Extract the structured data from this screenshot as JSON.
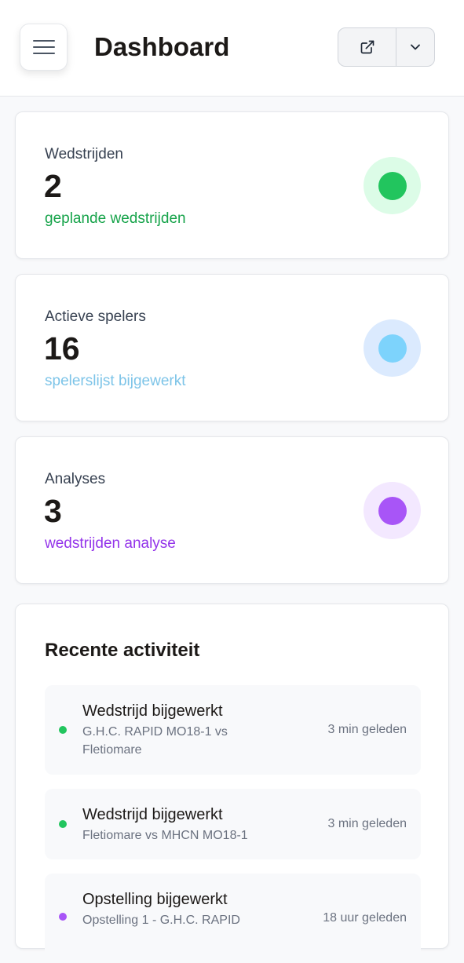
{
  "header": {
    "title": "Dashboard",
    "menu_icon": "hamburger-icon",
    "open_icon": "external-link-icon",
    "dropdown_icon": "chevron-down-icon"
  },
  "stats": [
    {
      "label": "Wedstrijden",
      "value": "2",
      "subtitle": "geplande wedstrijden",
      "accent": "#22c55e",
      "accent_text": "#16a34a",
      "accent_bg": "#dcfce7"
    },
    {
      "label": "Actieve spelers",
      "value": "16",
      "subtitle": "spelerslijst bijgewerkt",
      "accent": "#7dd3fc",
      "accent_text": "#7dc4e8",
      "accent_bg": "#dbeafe"
    },
    {
      "label": "Analyses",
      "value": "3",
      "subtitle": "wedstrijden analyse",
      "accent": "#a855f7",
      "accent_text": "#9333ea",
      "accent_bg": "#f3e8ff"
    }
  ],
  "activity": {
    "title": "Recente activiteit",
    "items": [
      {
        "title": "Wedstrijd bijgewerkt",
        "description": "G.H.C. RAPID MO18-1 vs Fletiomare",
        "time": "3 min geleden",
        "dot": "#22c55e"
      },
      {
        "title": "Wedstrijd bijgewerkt",
        "description": "Fletiomare vs MHCN MO18-1",
        "time": "3 min geleden",
        "dot": "#22c55e"
      },
      {
        "title": "Opstelling bijgewerkt",
        "description": "Opstelling 1 - G.H.C. RAPID",
        "time": "18 uur geleden",
        "dot": "#a855f7"
      }
    ]
  }
}
